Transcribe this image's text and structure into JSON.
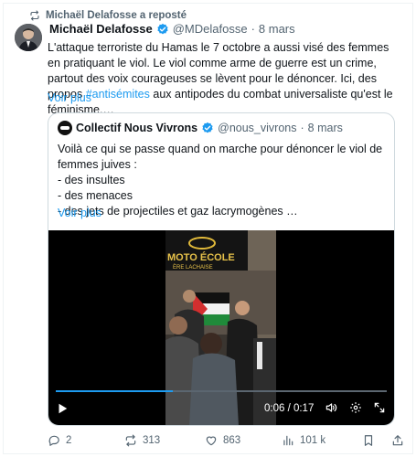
{
  "repost": {
    "label": "Michaël Delafosse a reposté",
    "icon": "repost-icon"
  },
  "tweet": {
    "name": "Michaël Delafosse",
    "handle": "@MDelafosse",
    "separator": "·",
    "date": "8 mars",
    "text_before_hashtag": "L'attaque terroriste du Hamas le 7 octobre a aussi visé des femmes en pratiquant le viol. Le viol comme arme de guerre est un crime, partout des voix courageuses se lèvent pour le dénoncer. Ici, des propos ",
    "hashtag": "#antisémites",
    "text_after_hashtag": " aux antipodes du combat universaliste qu'est le féminisme.…",
    "voir_plus": "Voir plus"
  },
  "quote": {
    "name": "Collectif Nous Vivrons",
    "handle": "@nous_vivrons",
    "separator": "·",
    "date": "8 mars",
    "lines": [
      "Voilà ce qui se passe quand on marche pour dénoncer le viol de",
      "femmes juives :",
      "- des insultes",
      "- des menaces",
      "- des jets de projectiles et gaz lacrymogènes …"
    ],
    "voir_plus": "Voir plus",
    "video": {
      "sign_line1": "MOTO ÉCOLE",
      "sign_line2": "ÈRE LACHAISE",
      "time": "0:06 / 0:17",
      "progress": 0.353
    }
  },
  "actions": {
    "replies": "2",
    "reposts": "313",
    "likes": "863",
    "views": "101 k"
  },
  "colors": {
    "accent": "#1d9bf0",
    "muted": "#536471",
    "text": "#0f1419"
  }
}
